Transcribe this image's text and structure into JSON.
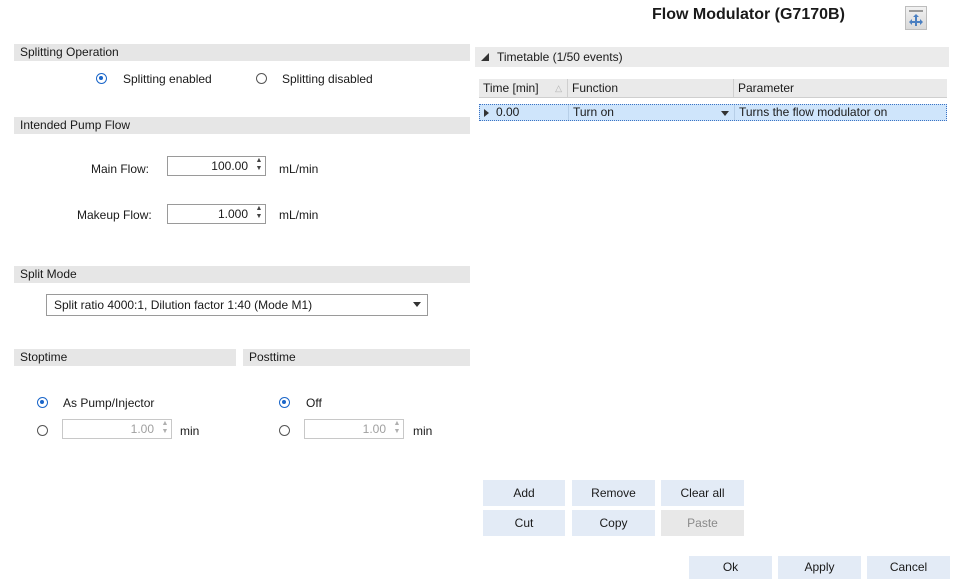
{
  "window": {
    "title": "Flow Modulator (G7170B)",
    "icon": "flow-modulator-icon"
  },
  "splitting": {
    "header": "Splitting Operation",
    "enabled_label": "Splitting enabled",
    "disabled_label": "Splitting disabled",
    "selected": "enabled"
  },
  "pump_flow": {
    "header": "Intended Pump Flow",
    "main_label": "Main Flow:",
    "main_value": "100.00",
    "main_unit": "mL/min",
    "makeup_label": "Makeup Flow:",
    "makeup_value": "1.000",
    "makeup_unit": "mL/min"
  },
  "split_mode": {
    "header": "Split Mode",
    "selected": "Split ratio 4000:1, Dilution factor 1:40 (Mode M1)"
  },
  "stoptime": {
    "header": "Stoptime",
    "option1": "As Pump/Injector",
    "value": "1.00",
    "unit": "min",
    "selected": "option1"
  },
  "posttime": {
    "header": "Posttime",
    "option1": "Off",
    "value": "1.00",
    "unit": "min",
    "selected": "option1"
  },
  "timetable": {
    "header": "Timetable (1/50 events)",
    "columns": [
      "Time [min]",
      "Function",
      "Parameter"
    ],
    "rows": [
      {
        "time": "0.00",
        "function": "Turn on",
        "parameter": "Turns the flow modulator on"
      }
    ]
  },
  "table_buttons": {
    "add": "Add",
    "remove": "Remove",
    "clear_all": "Clear all",
    "cut": "Cut",
    "copy": "Copy",
    "paste": "Paste"
  },
  "dialog_buttons": {
    "ok": "Ok",
    "apply": "Apply",
    "cancel": "Cancel"
  },
  "colors": {
    "accent": "#1a66c9",
    "selection": "#cfe5fb",
    "button": "#e3ebf6",
    "section": "#e6e6e6"
  }
}
